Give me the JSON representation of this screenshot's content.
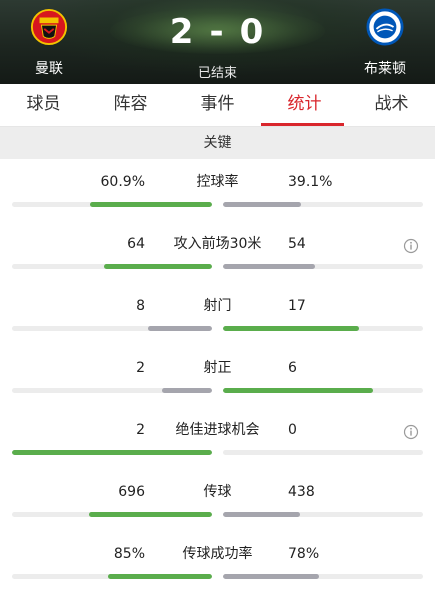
{
  "match": {
    "home_team": "曼联",
    "away_team": "布莱顿",
    "home_score": "2",
    "separator": "-",
    "away_score": "0",
    "status": "已结束"
  },
  "tabs": [
    {
      "label": "球员",
      "active": false
    },
    {
      "label": "阵容",
      "active": false
    },
    {
      "label": "事件",
      "active": false
    },
    {
      "label": "统计",
      "active": true
    },
    {
      "label": "战术",
      "active": false
    }
  ],
  "section": {
    "title": "关键"
  },
  "colors": {
    "accent": "#d9262c",
    "win_bar": "#5aad4c",
    "lose_bar": "#a5a5ad",
    "track": "#ececec"
  },
  "stats": [
    {
      "label": "控球率",
      "home": "60.9%",
      "away": "39.1%",
      "home_v": 60.9,
      "away_v": 39.1,
      "info": false
    },
    {
      "label": "攻入前场30米",
      "home": "64",
      "away": "54",
      "home_v": 64,
      "away_v": 54,
      "info": true
    },
    {
      "label": "射门",
      "home": "8",
      "away": "17",
      "home_v": 8,
      "away_v": 17,
      "info": false
    },
    {
      "label": "射正",
      "home": "2",
      "away": "6",
      "home_v": 2,
      "away_v": 6,
      "info": false
    },
    {
      "label": "绝佳进球机会",
      "home": "2",
      "away": "0",
      "home_v": 2,
      "away_v": 0,
      "info": true
    },
    {
      "label": "传球",
      "home": "696",
      "away": "438",
      "home_v": 696,
      "away_v": 438,
      "info": false
    },
    {
      "label": "传球成功率",
      "home": "85%",
      "away": "78%",
      "home_v": 85,
      "away_v": 78,
      "info": false
    }
  ]
}
